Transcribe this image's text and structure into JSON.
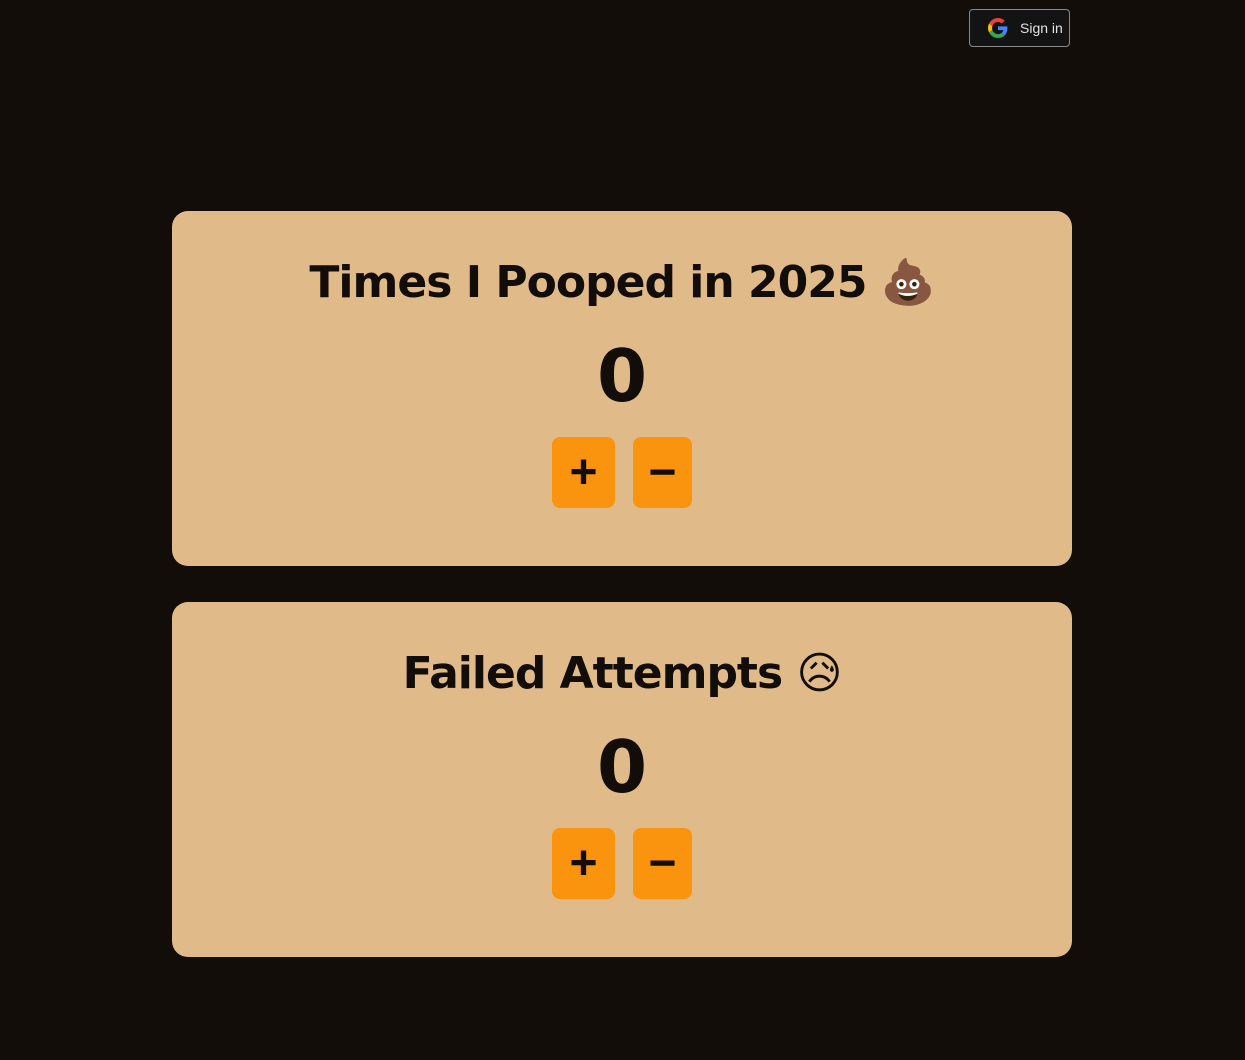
{
  "header": {
    "signin_label": "Sign in",
    "signin_icon": "google-icon"
  },
  "counters": [
    {
      "title": "Times I Pooped in 2025 💩",
      "value": "0",
      "plus": "+",
      "minus": "−"
    },
    {
      "title": "Failed Attempts 😥",
      "value": "0",
      "plus": "+",
      "minus": "−"
    }
  ],
  "colors": {
    "background": "#120d09",
    "card": "#e0bb89",
    "button": "#fa930e"
  }
}
